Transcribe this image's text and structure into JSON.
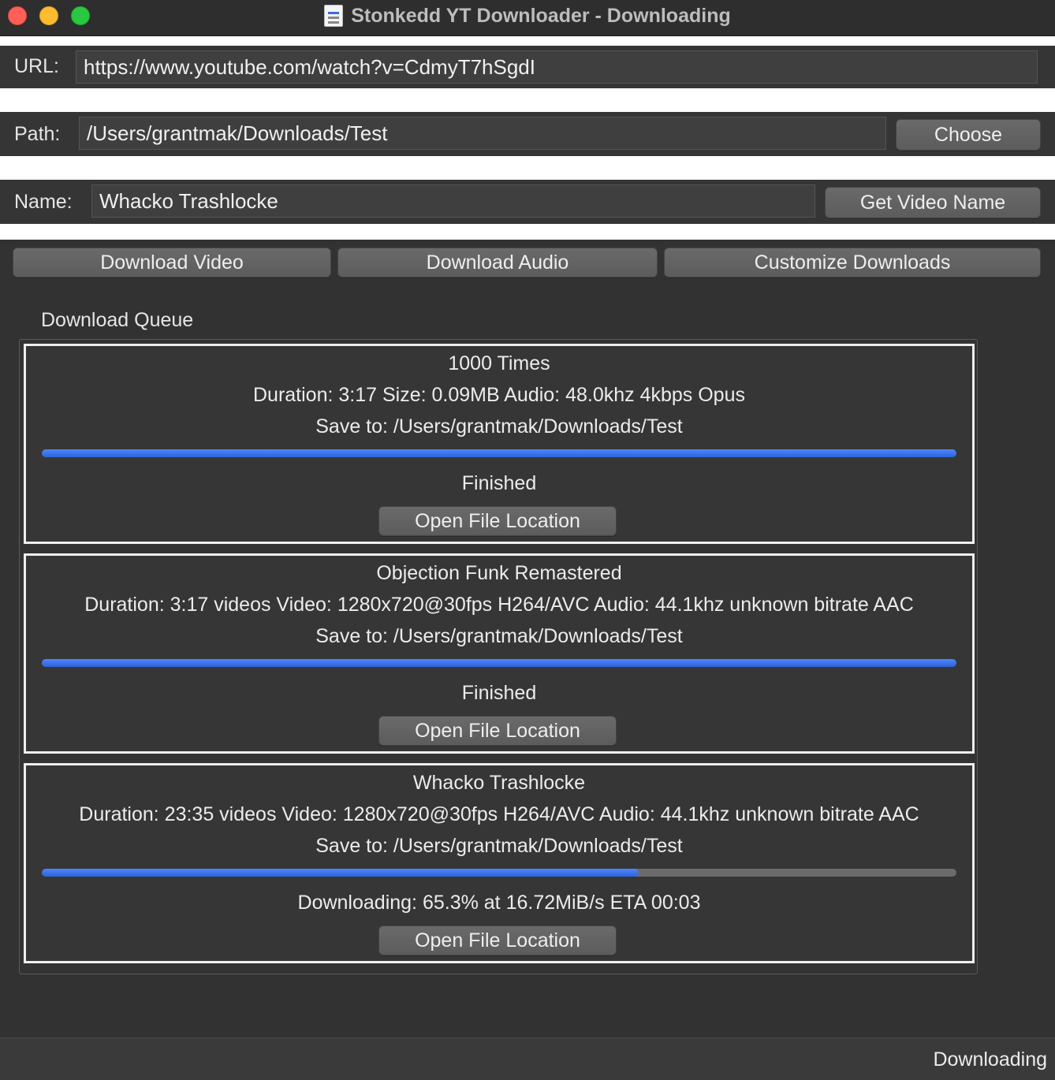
{
  "window": {
    "title": "Stonkedd YT Downloader - Downloading"
  },
  "url_row": {
    "label": "URL:",
    "value": "https://www.youtube.com/watch?v=CdmyT7hSgdI"
  },
  "path_row": {
    "label": "Path:",
    "value": "/Users/grantmak/Downloads/Test",
    "button": "Choose"
  },
  "name_row": {
    "label": "Name:",
    "value": "Whacko Trashlocke",
    "button": "Get Video Name"
  },
  "actions": {
    "download_video": "Download Video",
    "download_audio": "Download Audio",
    "customize": "Customize Downloads"
  },
  "queue": {
    "heading": "Download Queue",
    "items": [
      {
        "title": "1000 Times",
        "details": "Duration: 3:17  Size: 0.09MB Audio: 48.0khz 4kbps Opus",
        "save_to": "Save to: /Users/grantmak/Downloads/Test",
        "progress": 1.0,
        "status": "Finished",
        "button": "Open File Location"
      },
      {
        "title": "Objection Funk Remastered",
        "details": "Duration: 3:17  videos  Video: 1280x720@30fps H264/AVC Audio: 44.1khz unknown bitrate AAC",
        "save_to": "Save to: /Users/grantmak/Downloads/Test",
        "progress": 1.0,
        "status": "Finished",
        "button": "Open File Location"
      },
      {
        "title": "Whacko Trashlocke",
        "details": "Duration: 23:35 videos  Video: 1280x720@30fps H264/AVC Audio: 44.1khz unknown bitrate AAC",
        "save_to": "Save to: /Users/grantmak/Downloads/Test",
        "progress": 0.653,
        "status": "Downloading: 65.3% at   16.72MiB/s ETA 00:03",
        "button": "Open File Location"
      }
    ]
  },
  "statusbar": {
    "text": "Downloading"
  },
  "colors": {
    "accent": "#3a72ef",
    "background": "#323232",
    "button": "#636363"
  }
}
